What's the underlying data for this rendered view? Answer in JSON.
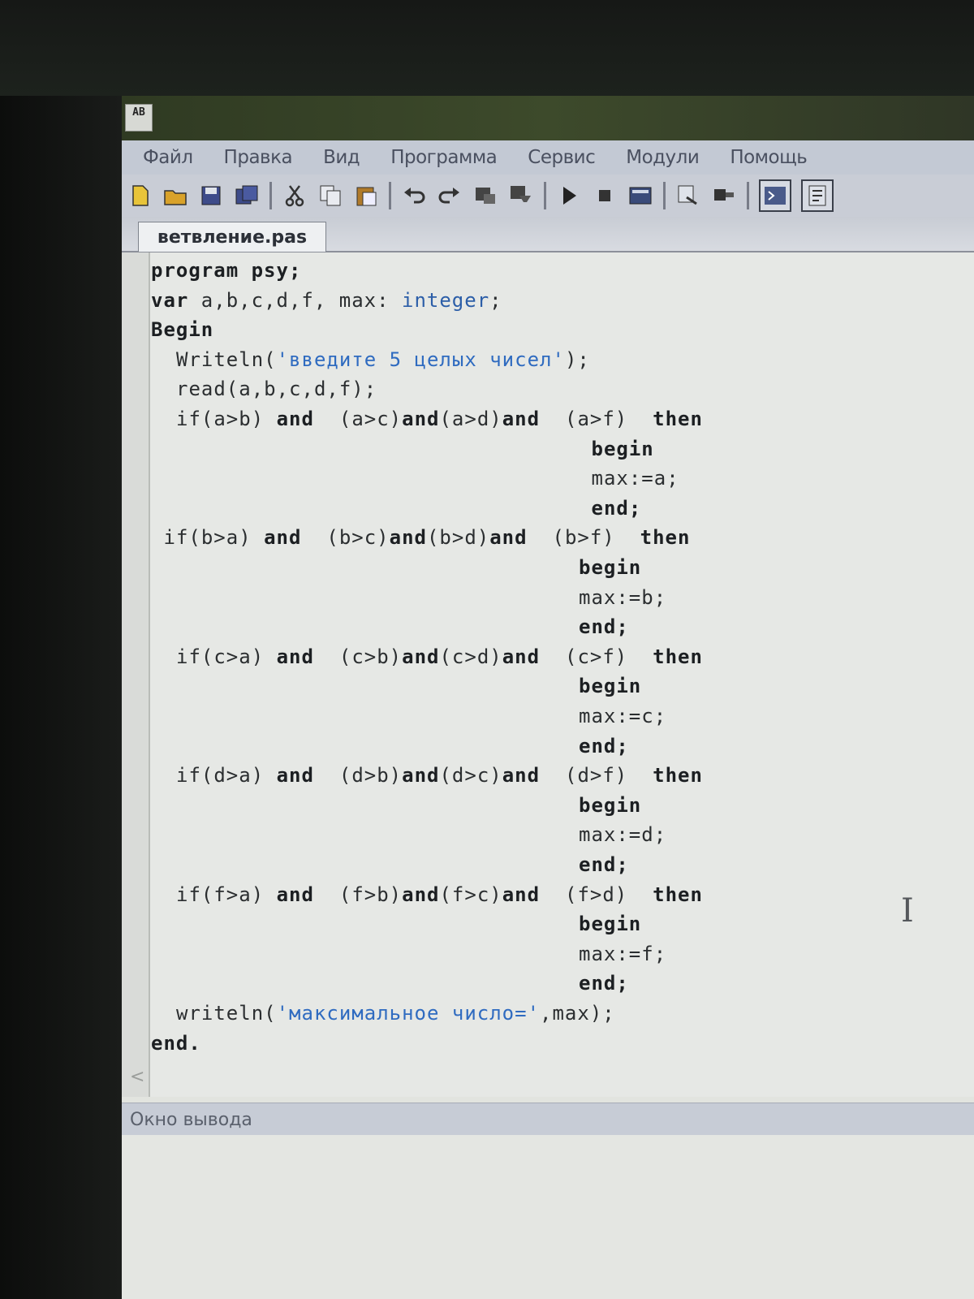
{
  "app": {
    "icon_text": "AB"
  },
  "menu": [
    "Файл",
    "Правка",
    "Вид",
    "Программа",
    "Сервис",
    "Модули",
    "Помощь"
  ],
  "toolbar": {
    "icons": [
      "new-file-icon",
      "open-folder-icon",
      "save-icon",
      "save-all-icon",
      "cut-icon",
      "copy-icon",
      "paste-icon",
      "undo-icon",
      "redo-icon",
      "find-icon",
      "replace-icon",
      "run-icon",
      "stop-icon",
      "compile-icon",
      "debug-icon",
      "step-icon",
      "output-window-icon",
      "properties-icon"
    ]
  },
  "tab": {
    "label": "ветвление.pas"
  },
  "code": [
    {
      "indent": 0,
      "segments": [
        {
          "t": "program psy;",
          "c": "kw"
        }
      ]
    },
    {
      "indent": 0,
      "segments": [
        {
          "t": "var",
          "c": "kw"
        },
        {
          "t": " a,b,c,d,f, max: ",
          "c": ""
        },
        {
          "t": "integer",
          "c": "ty"
        },
        {
          "t": ";",
          "c": ""
        }
      ]
    },
    {
      "indent": 0,
      "segments": [
        {
          "t": "Begin",
          "c": "kw"
        }
      ]
    },
    {
      "indent": 2,
      "segments": [
        {
          "t": "Writeln(",
          "c": ""
        },
        {
          "t": "'введите 5 целых чисел'",
          "c": "st"
        },
        {
          "t": ");",
          "c": ""
        }
      ]
    },
    {
      "indent": 2,
      "segments": [
        {
          "t": "read(a,b,c,d,f);",
          "c": ""
        }
      ]
    },
    {
      "indent": 2,
      "segments": [
        {
          "t": "if",
          "c": ""
        },
        {
          "t": "(a>b) ",
          "c": ""
        },
        {
          "t": "and",
          "c": "kw"
        },
        {
          "t": "  (a>c)",
          "c": ""
        },
        {
          "t": "and",
          "c": "kw"
        },
        {
          "t": "(a>d)",
          "c": ""
        },
        {
          "t": "and",
          "c": "kw"
        },
        {
          "t": "  (a>f)  ",
          "c": ""
        },
        {
          "t": "then",
          "c": "kw"
        }
      ]
    },
    {
      "indent": 35,
      "segments": [
        {
          "t": "begin",
          "c": "kw"
        }
      ]
    },
    {
      "indent": 35,
      "segments": [
        {
          "t": "max:=a;",
          "c": ""
        }
      ]
    },
    {
      "indent": 35,
      "segments": [
        {
          "t": "end;",
          "c": "kw"
        }
      ]
    },
    {
      "indent": 1,
      "segments": [
        {
          "t": "if",
          "c": ""
        },
        {
          "t": "(b>a) ",
          "c": ""
        },
        {
          "t": "and",
          "c": "kw"
        },
        {
          "t": "  (b>c)",
          "c": ""
        },
        {
          "t": "and",
          "c": "kw"
        },
        {
          "t": "(b>d)",
          "c": ""
        },
        {
          "t": "and",
          "c": "kw"
        },
        {
          "t": "  (b>f)  ",
          "c": ""
        },
        {
          "t": "then",
          "c": "kw"
        }
      ]
    },
    {
      "indent": 34,
      "segments": [
        {
          "t": "begin",
          "c": "kw"
        }
      ]
    },
    {
      "indent": 34,
      "segments": [
        {
          "t": "max:=b;",
          "c": ""
        }
      ]
    },
    {
      "indent": 34,
      "segments": [
        {
          "t": "end;",
          "c": "kw"
        }
      ]
    },
    {
      "indent": 2,
      "segments": [
        {
          "t": "if",
          "c": ""
        },
        {
          "t": "(c>a) ",
          "c": ""
        },
        {
          "t": "and",
          "c": "kw"
        },
        {
          "t": "  (c>b)",
          "c": ""
        },
        {
          "t": "and",
          "c": "kw"
        },
        {
          "t": "(c>d)",
          "c": ""
        },
        {
          "t": "and",
          "c": "kw"
        },
        {
          "t": "  (c>f)  ",
          "c": ""
        },
        {
          "t": "then",
          "c": "kw"
        }
      ]
    },
    {
      "indent": 34,
      "segments": [
        {
          "t": "begin",
          "c": "kw"
        }
      ]
    },
    {
      "indent": 34,
      "segments": [
        {
          "t": "max:=c;",
          "c": ""
        }
      ]
    },
    {
      "indent": 34,
      "segments": [
        {
          "t": "end;",
          "c": "kw"
        }
      ]
    },
    {
      "indent": 2,
      "segments": [
        {
          "t": "if",
          "c": ""
        },
        {
          "t": "(d>a) ",
          "c": ""
        },
        {
          "t": "and",
          "c": "kw"
        },
        {
          "t": "  (d>b)",
          "c": ""
        },
        {
          "t": "and",
          "c": "kw"
        },
        {
          "t": "(d>c)",
          "c": ""
        },
        {
          "t": "and",
          "c": "kw"
        },
        {
          "t": "  (d>f)  ",
          "c": ""
        },
        {
          "t": "then",
          "c": "kw"
        }
      ]
    },
    {
      "indent": 34,
      "segments": [
        {
          "t": "begin",
          "c": "kw"
        }
      ]
    },
    {
      "indent": 34,
      "segments": [
        {
          "t": "max:=d;",
          "c": ""
        }
      ]
    },
    {
      "indent": 34,
      "segments": [
        {
          "t": "end;",
          "c": "kw"
        }
      ]
    },
    {
      "indent": 2,
      "segments": [
        {
          "t": "if",
          "c": ""
        },
        {
          "t": "(f>a) ",
          "c": ""
        },
        {
          "t": "and",
          "c": "kw"
        },
        {
          "t": "  (f>b)",
          "c": ""
        },
        {
          "t": "and",
          "c": "kw"
        },
        {
          "t": "(f>c)",
          "c": ""
        },
        {
          "t": "and",
          "c": "kw"
        },
        {
          "t": "  (f>d)  ",
          "c": ""
        },
        {
          "t": "then",
          "c": "kw"
        }
      ]
    },
    {
      "indent": 34,
      "segments": [
        {
          "t": "begin",
          "c": "kw"
        }
      ]
    },
    {
      "indent": 34,
      "segments": [
        {
          "t": "max:=f;",
          "c": ""
        }
      ]
    },
    {
      "indent": 34,
      "segments": [
        {
          "t": "end;",
          "c": "kw"
        }
      ]
    },
    {
      "indent": 2,
      "segments": [
        {
          "t": "writeln(",
          "c": ""
        },
        {
          "t": "'максимальное число='",
          "c": "st"
        },
        {
          "t": ",max);",
          "c": ""
        }
      ]
    },
    {
      "indent": 0,
      "segments": [
        {
          "t": "end.",
          "c": "kw"
        }
      ]
    }
  ],
  "scroll_hint": "<",
  "output": {
    "title": "Окно вывода"
  }
}
